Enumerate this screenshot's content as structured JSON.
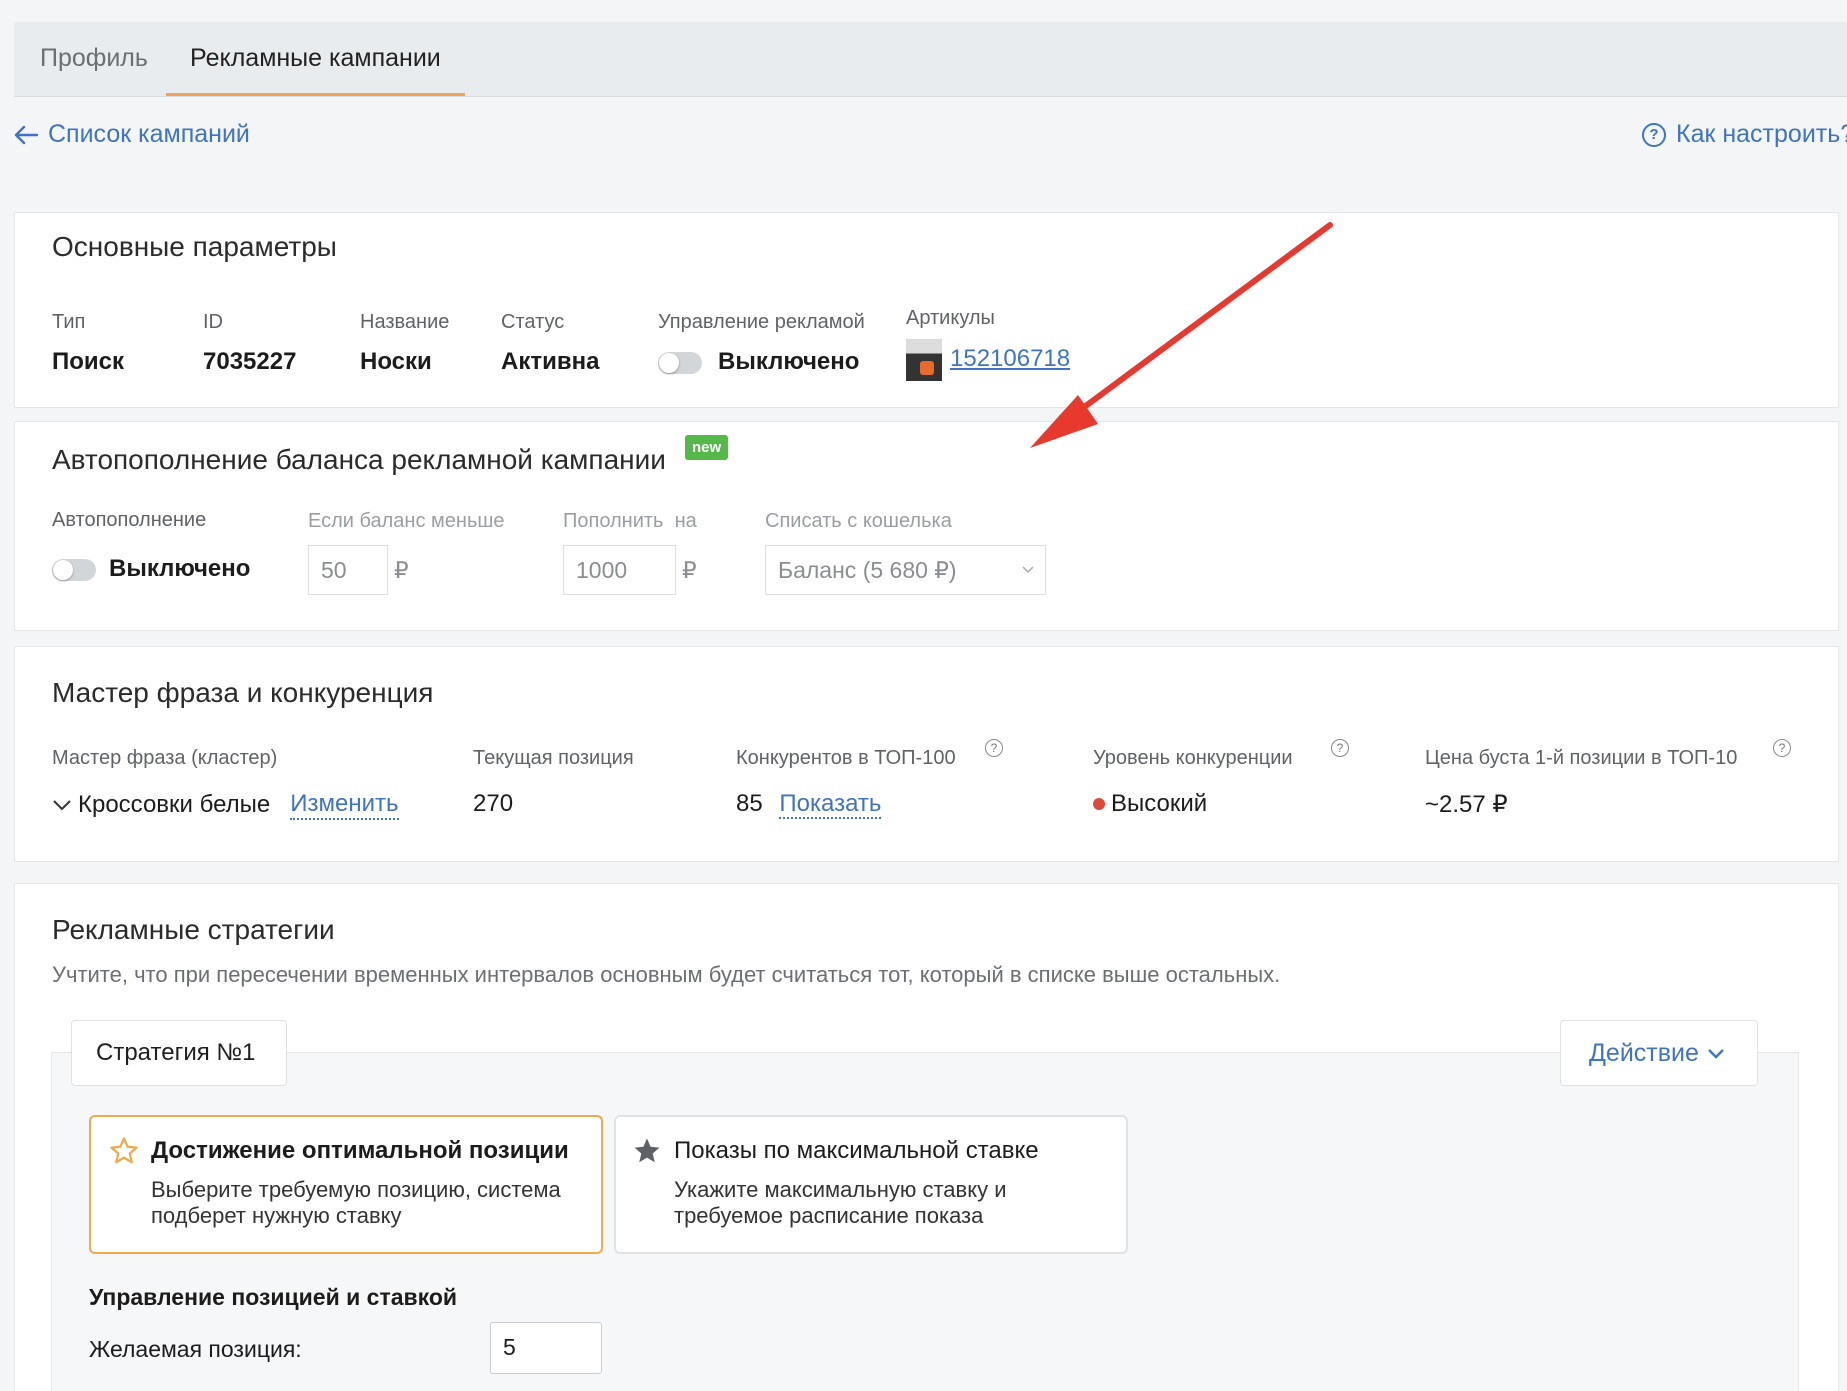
{
  "tabs": [
    {
      "label": "Профиль"
    },
    {
      "label": "Рекламные кампании"
    }
  ],
  "nav": {
    "back_label": "Список кампаний",
    "help_label": "Как настроить?"
  },
  "basic": {
    "title": "Основные параметры",
    "type_label": "Тип",
    "type_value": "Поиск",
    "id_label": "ID",
    "id_value": "7035227",
    "name_label": "Название",
    "name_value": "Носки",
    "status_label": "Статус",
    "status_value": "Активна",
    "ad_control_label": "Управление рекламой",
    "ad_control_value": "Выключено",
    "articles_label": "Артикулы",
    "article_value": "152106718"
  },
  "autofill": {
    "title": "Автопополнение баланса рекламной кампании",
    "badge": "new",
    "toggle_label": "Автопополнение",
    "toggle_value": "Выключено",
    "threshold_label": "Если баланс меньше",
    "threshold_value": "50",
    "topup_label": "Пополнить  на",
    "topup_value": "1000",
    "currency": "₽",
    "wallet_label": "Списать с кошелька",
    "wallet_value": "Баланс (5 680 ₽)"
  },
  "master": {
    "title": "Мастер фраза и конкуренция",
    "phrase_label": "Мастер фраза (кластер)",
    "phrase_value": "Кроссовки белые",
    "change_link": "Изменить",
    "position_label": "Текущая позиция",
    "position_value": "270",
    "competitors_label": "Конкурентов в ТОП-100",
    "competitors_value": "85",
    "show_link": "Показать",
    "level_label": "Уровень конкуренции",
    "level_value": "Высокий",
    "price_label": "Цена буста 1-й позиции в ТОП-10",
    "price_value": "~2.57 ₽",
    "level_color": "#e0483c"
  },
  "strategies": {
    "title": "Рекламные стратегии",
    "note": "Учтите, что при пересечении временных интервалов основным будет считаться тот, который в списке выше остальных.",
    "strategy_tab": "Стратегия №1",
    "action_label": "Действие",
    "option1_title": "Достижение оптимальной позиции",
    "option1_desc": "Выберите требуемую позицию, система подберет нужную ставку",
    "option2_title": "Показы по максимальной ставке",
    "option2_desc": "Укажите максимальную ставку и требуемое расписание показа",
    "control_title": "Управление позицией и ставкой",
    "desired_label": "Желаемая позиция:",
    "desired_value": "5"
  },
  "colors": {
    "accent": "#f0a35e",
    "link": "#3f73c4",
    "annotation_arrow": "#e8392f"
  }
}
